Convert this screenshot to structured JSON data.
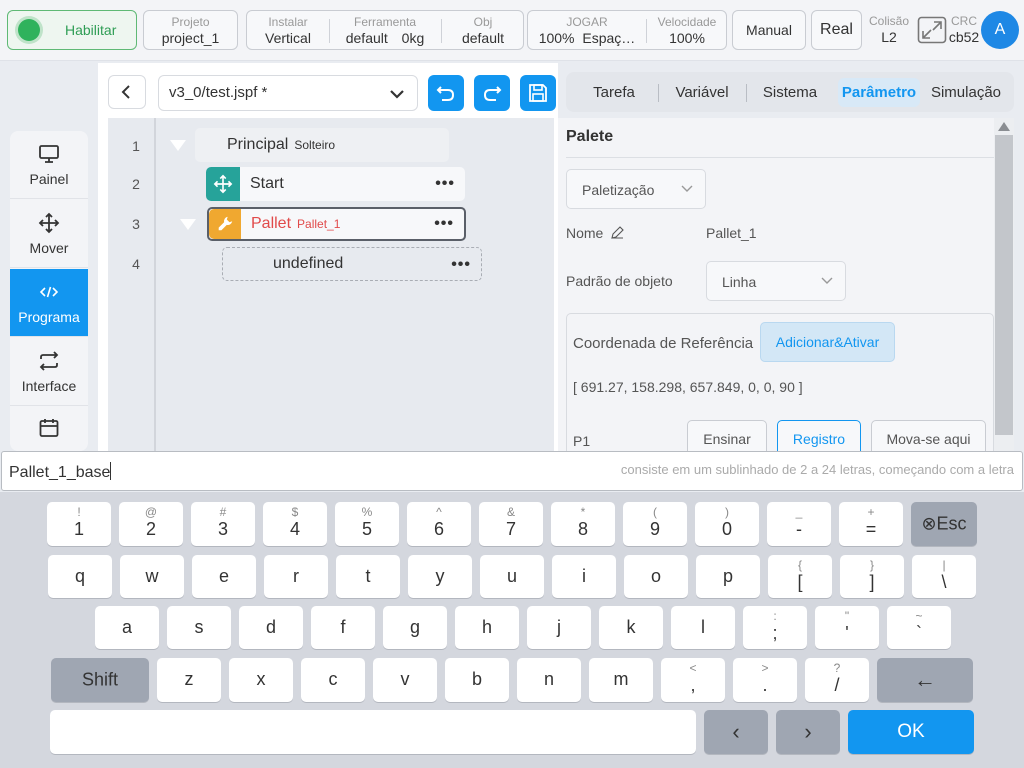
{
  "topbar": {
    "enable_label": "Habilitar",
    "project": {
      "label": "Projeto",
      "value": "project_1"
    },
    "install": {
      "label": "Instalar",
      "value": "Vertical"
    },
    "tool": {
      "label": "Ferramenta",
      "value": "default",
      "weight": "0kg"
    },
    "obj": {
      "label": "Obj",
      "value": "default"
    },
    "jog": {
      "label": "JOGAR",
      "value": "100%",
      "space": "Espaç…"
    },
    "speed": {
      "label": "Velocidade",
      "value": "100%"
    },
    "manual_label": "Manual",
    "real_label": "Real",
    "collision": {
      "label": "Colisão",
      "value": "L2"
    },
    "crc": {
      "label": "CRC",
      "value": "cb52"
    },
    "avatar_letter": "A"
  },
  "leftnav": {
    "items": [
      {
        "label": "Painel",
        "icon": "monitor-icon"
      },
      {
        "label": "Mover",
        "icon": "move-icon"
      },
      {
        "label": "Programa",
        "icon": "code-icon",
        "active": true
      },
      {
        "label": "Interface",
        "icon": "swap-icon"
      },
      {
        "label": "",
        "icon": "calendar-icon"
      }
    ]
  },
  "editor": {
    "file_name": "v3_0/test.jspf *",
    "tree": [
      {
        "line": "1",
        "name": "Principal",
        "sub": "Solteiro"
      },
      {
        "line": "2",
        "name": "Start",
        "icon": "move-icon",
        "color": "#26a39a"
      },
      {
        "line": "3",
        "name": "Pallet",
        "sub": "Pallet_1",
        "icon": "wrench-icon",
        "color": "#f0a830"
      },
      {
        "line": "4",
        "name": "undefined"
      }
    ],
    "more_glyph": "•••"
  },
  "tabs": {
    "items": [
      "Tarefa",
      "Variável",
      "Sistema",
      "Parâmetro",
      "Simulação"
    ],
    "active_index": 3
  },
  "panel": {
    "title": "Palete",
    "mode_select": "Paletização",
    "name_label": "Nome",
    "name_value": "Pallet_1",
    "pattern_label": "Padrão de objeto",
    "pattern_value": "Linha",
    "coord_label": "Coordenada de Referência",
    "add_activate_label": "Adicionar&Ativar",
    "coord_value": "[ 691.27, 158.298, 657.849, 0, 0, 90 ]",
    "p1_label": "P1",
    "teach_label": "Ensinar",
    "record_label": "Registro",
    "move_here_label": "Mova-se aqui"
  },
  "input": {
    "value": "Pallet_1_base",
    "hint": "consiste em um sublinhado de 2 a 24 letras, começando com a letra"
  },
  "keyboard": {
    "row1": [
      {
        "sub": "!",
        "main": "1"
      },
      {
        "sub": "@",
        "main": "2"
      },
      {
        "sub": "#",
        "main": "3"
      },
      {
        "sub": "$",
        "main": "4"
      },
      {
        "sub": "%",
        "main": "5"
      },
      {
        "sub": "^",
        "main": "6"
      },
      {
        "sub": "&",
        "main": "7"
      },
      {
        "sub": "*",
        "main": "8"
      },
      {
        "sub": "(",
        "main": "9"
      },
      {
        "sub": ")",
        "main": "0"
      },
      {
        "sub": "_",
        "main": "-"
      },
      {
        "sub": "+",
        "main": "="
      }
    ],
    "esc_label": "⊗Esc",
    "row2": [
      {
        "main": "q"
      },
      {
        "main": "w"
      },
      {
        "main": "e"
      },
      {
        "main": "r"
      },
      {
        "main": "t"
      },
      {
        "main": "y"
      },
      {
        "main": "u"
      },
      {
        "main": "i"
      },
      {
        "main": "o"
      },
      {
        "main": "p"
      },
      {
        "sub": "{",
        "main": "["
      },
      {
        "sub": "}",
        "main": "]"
      },
      {
        "sub": "|",
        "main": "\\"
      }
    ],
    "row3": [
      {
        "main": "a"
      },
      {
        "main": "s"
      },
      {
        "main": "d"
      },
      {
        "main": "f"
      },
      {
        "main": "g"
      },
      {
        "main": "h"
      },
      {
        "main": "j"
      },
      {
        "main": "k"
      },
      {
        "main": "l"
      },
      {
        "sub": ":",
        "main": ";"
      },
      {
        "sub": "\"",
        "main": "'"
      },
      {
        "sub": "~",
        "main": "`"
      }
    ],
    "shift_label": "Shift",
    "row4": [
      {
        "main": "z"
      },
      {
        "main": "x"
      },
      {
        "main": "c"
      },
      {
        "main": "v"
      },
      {
        "main": "b"
      },
      {
        "main": "n"
      },
      {
        "main": "m"
      },
      {
        "sub": "<",
        "main": ","
      },
      {
        "sub": ">",
        "main": "."
      },
      {
        "sub": "?",
        "main": "/"
      }
    ],
    "backspace_label": "←",
    "left_label": "‹",
    "right_label": "›",
    "ok_label": "OK"
  }
}
